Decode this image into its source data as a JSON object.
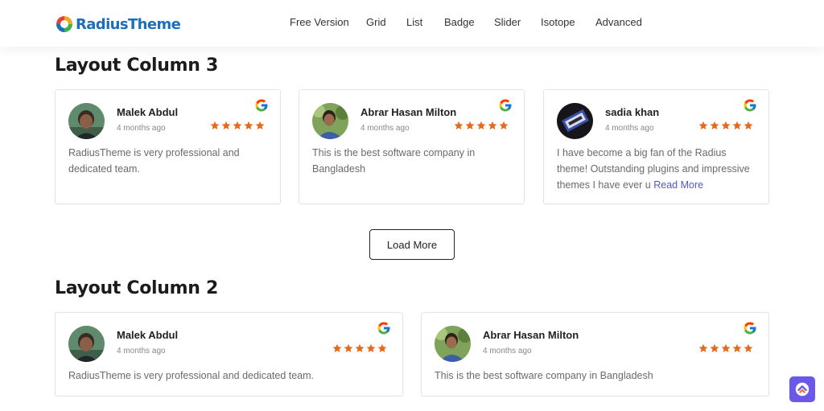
{
  "header": {
    "logo_text": "RadiusTheme",
    "nav": [
      {
        "label": "Free Version"
      },
      {
        "label": "Grid"
      },
      {
        "label": "List"
      },
      {
        "label": "Badge"
      },
      {
        "label": "Slider"
      },
      {
        "label": "Isotope"
      },
      {
        "label": "Advanced"
      }
    ]
  },
  "sections": [
    {
      "title": "Layout Column 3",
      "reviews": [
        {
          "name": "Malek Abdul",
          "time": "4 months ago",
          "rating": 5,
          "text": "RadiusTheme is very professional and dedicated team.",
          "avatar": "avatar-man-green"
        },
        {
          "name": "Abrar Hasan Milton",
          "time": "4 months ago",
          "rating": 5,
          "text": "This is the best software company in Bangladesh",
          "avatar": "avatar-man-outdoor"
        },
        {
          "name": "sadia khan",
          "time": "4 months ago",
          "rating": 5,
          "text": "I have become a big fan of the Radius theme! Outstanding plugins and impressive themes I have ever u",
          "read_more": "Read More",
          "avatar": "avatar-dark-graphic"
        }
      ],
      "load_more_label": "Load More"
    },
    {
      "title": "Layout Column 2",
      "reviews": [
        {
          "name": "Malek Abdul",
          "time": "4 months ago",
          "rating": 5,
          "text": "RadiusTheme is very professional and dedicated team.",
          "avatar": "avatar-man-green"
        },
        {
          "name": "Abrar Hasan Milton",
          "time": "4 months ago",
          "rating": 5,
          "text": "This is the best software company in Bangladesh",
          "avatar": "avatar-man-outdoor"
        }
      ]
    }
  ],
  "colors": {
    "star": "#e56a1c",
    "brand_blue": "#1d6fb8",
    "read_more": "#4e59c9",
    "float_button": "#6a58e8"
  },
  "icons": {
    "google": "google-g-icon",
    "star": "star-icon",
    "floating": "chat-widget-icon"
  }
}
